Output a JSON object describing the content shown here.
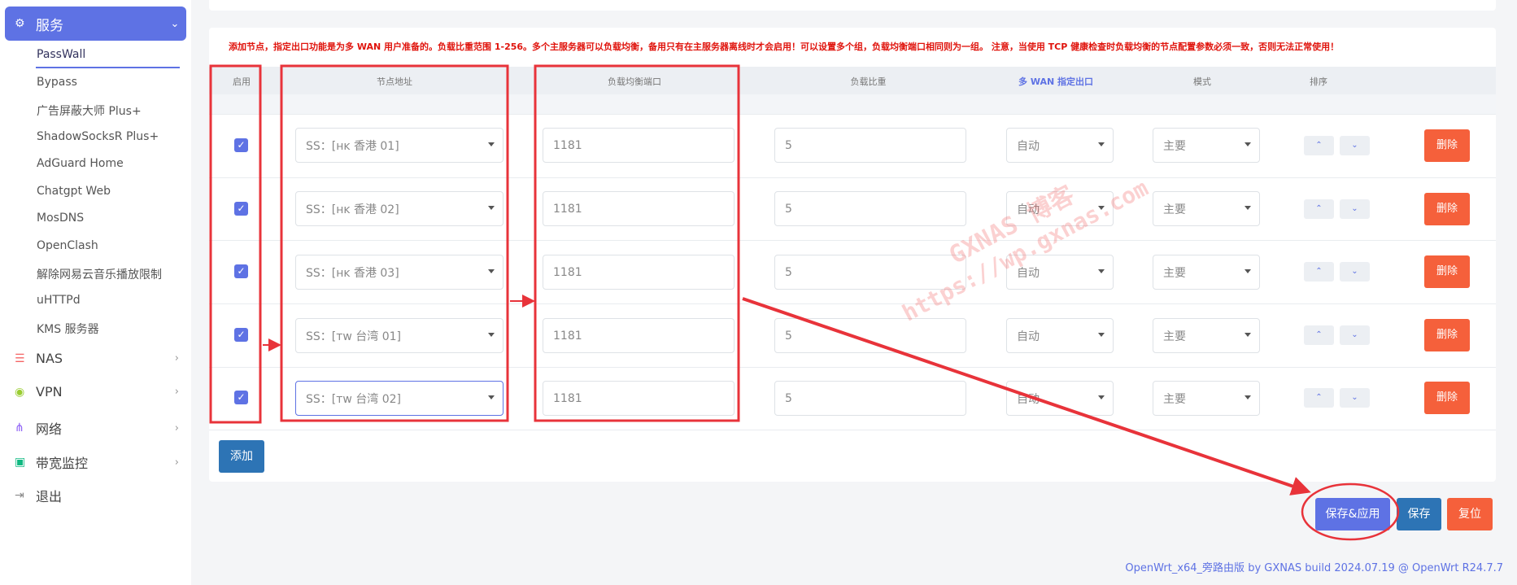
{
  "sidebar": {
    "active_group": {
      "label": "服务",
      "icon": "gears-icon"
    },
    "sub_items": [
      "PassWall",
      "Bypass",
      "广告屏蔽大师 Plus+",
      "ShadowSocksR Plus+",
      "AdGuard Home",
      "Chatgpt Web",
      "MosDNS",
      "OpenClash",
      "解除网易云音乐播放限制",
      "uHTTPd",
      "KMS 服务器"
    ],
    "groups": [
      {
        "label": "NAS",
        "icon": "database-icon",
        "icon_color": "#f56565"
      },
      {
        "label": "VPN",
        "icon": "vpn-icon",
        "icon_color": "#9acd32"
      },
      {
        "label": "网络",
        "icon": "network-icon",
        "icon_color": "#8b5cf6"
      },
      {
        "label": "带宽监控",
        "icon": "monitor-icon",
        "icon_color": "#10b981"
      },
      {
        "label": "退出",
        "icon": "logout-icon",
        "icon_color": "#888888"
      }
    ]
  },
  "notice": "添加节点，指定出口功能是为多 WAN 用户准备的。负载比重范围 1-256。多个主服务器可以负载均衡，备用只有在主服务器离线时才会启用！可以设置多个组，负载均衡端口相同则为一组。 注意，当使用 TCP 健康检查时负载均衡的节点配置参数必须一致，否则无法正常使用！",
  "table": {
    "headers": [
      "启用",
      "节点地址",
      "负载均衡端口",
      "负载比重",
      "多 WAN 指定出口",
      "模式",
      "排序"
    ],
    "rows": [
      {
        "enabled": true,
        "node": "SS：[ʜᴋ 香港 01]",
        "port": "1181",
        "weight": "5",
        "wan": "自动",
        "mode": "主要"
      },
      {
        "enabled": true,
        "node": "SS：[ʜᴋ 香港 02]",
        "port": "1181",
        "weight": "5",
        "wan": "自动",
        "mode": "主要"
      },
      {
        "enabled": true,
        "node": "SS：[ʜᴋ 香港 03]",
        "port": "1181",
        "weight": "5",
        "wan": "自动",
        "mode": "主要"
      },
      {
        "enabled": true,
        "node": "SS：[ᴛᴡ 台湾 01]",
        "port": "1181",
        "weight": "5",
        "wan": "自动",
        "mode": "主要"
      },
      {
        "enabled": true,
        "node": "SS：[ᴛᴡ 台湾 02]",
        "port": "1181",
        "weight": "5",
        "wan": "自动",
        "mode": "主要"
      }
    ],
    "up_glyph": "⌃",
    "down_glyph": "⌄",
    "delete_label": "删除"
  },
  "add_label": "添加",
  "actions": {
    "save_apply": "保存&应用",
    "save": "保存",
    "reset": "复位"
  },
  "footer": "OpenWrt_x64_旁路由版 by GXNAS build 2024.07.19 @ OpenWrt R24.7.7",
  "watermark": {
    "line1": "GXNAS 博客",
    "line2": "https://wp.gxnas.com"
  },
  "colors": {
    "accent": "#5e72e4",
    "delete": "#f5603b",
    "save_blue": "#2d74b5",
    "notice_red": "#e0140d",
    "annotation_red": "#e8333a"
  }
}
